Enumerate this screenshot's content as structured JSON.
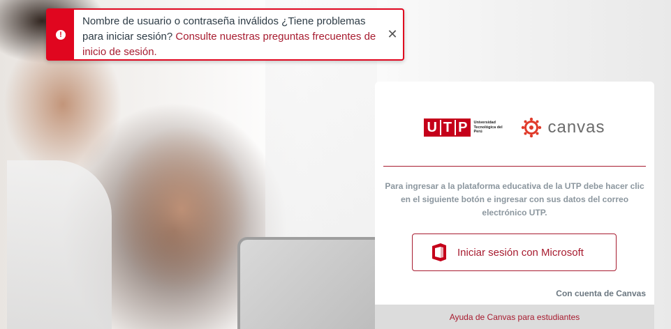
{
  "alert": {
    "message": "Nombre de usuario o contraseña inválidos ¿Tiene problemas para iniciar sesión? ",
    "link_text": "Consulte nuestras preguntas frecuentes de inicio de sesión.",
    "icon": "exclamation-icon",
    "close_icon": "close-icon",
    "color": "#e0061f"
  },
  "logos": {
    "utp_letters": [
      "U",
      "T",
      "P"
    ],
    "utp_subtitle": "Universidad Tecnológica del Perú",
    "canvas_word": "canvas"
  },
  "login": {
    "intro": "Para ingresar a la plataforma educativa de la UTP debe hacer clic en el siguiente botón e ingresar con sus datos del correo electrónico UTP.",
    "microsoft_button_label": "Iniciar sesión con Microsoft",
    "microsoft_icon": "office-icon",
    "canvas_account_link": "Con cuenta de Canvas",
    "help_link": "Ayuda de Canvas para estudiantes"
  },
  "colors": {
    "brand": "#a71b2f",
    "utp_red": "#c5001a",
    "help_bar": "#dcdcdc"
  }
}
